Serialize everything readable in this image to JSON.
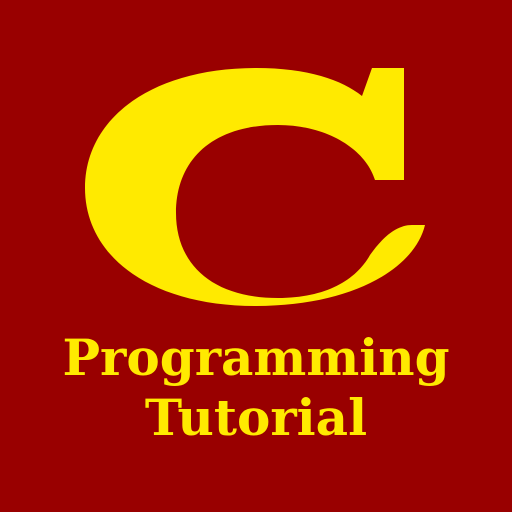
{
  "logo": {
    "letter": "C",
    "background_color": "#990000",
    "foreground_color": "#ffea00"
  },
  "title": {
    "line1": "Programming",
    "line2": "Tutorial"
  }
}
